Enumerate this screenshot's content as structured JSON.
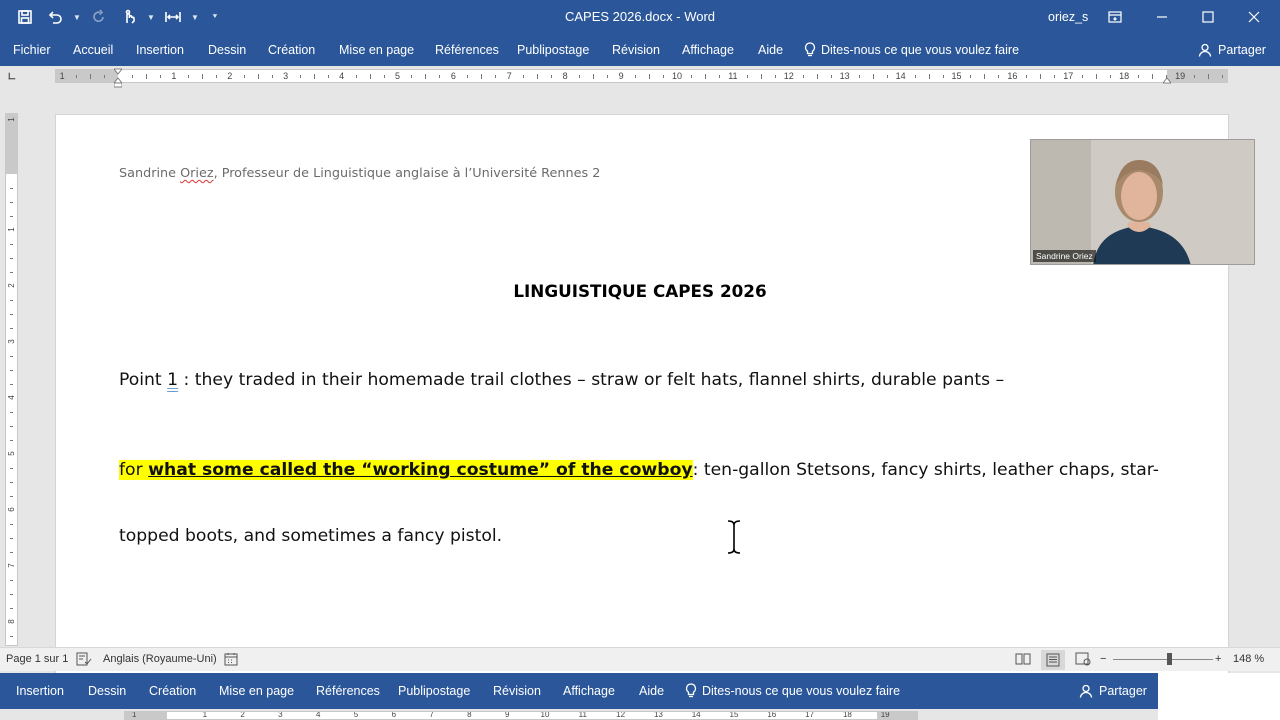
{
  "window": {
    "title": "CAPES 2026.docx - Word",
    "user": "oriez_s"
  },
  "ribbon": {
    "tabs": [
      "Fichier",
      "Accueil",
      "Insertion",
      "Dessin",
      "Création",
      "Mise en page",
      "Références",
      "Publipostage",
      "Révision",
      "Affichage",
      "Aide"
    ],
    "tell_me": "Dites-nous ce que vous voulez faire",
    "share": "Partager"
  },
  "ruler": {
    "labels": [
      "1",
      "1",
      "2",
      "3",
      "4",
      "5",
      "6",
      "7",
      "8",
      "9",
      "10",
      "11",
      "12",
      "13",
      "14",
      "15",
      "16",
      "17",
      "18",
      "19"
    ],
    "vertical_labels": [
      "1",
      "1",
      "2",
      "3",
      "4",
      "5",
      "6",
      "7",
      "8"
    ]
  },
  "document": {
    "header_name": "Oriez",
    "header_prefix": "Sandrine ",
    "header_suffix": ", Professeur de Linguistique anglaise à l’Université Rennes 2",
    "title": "LINGUISTIQUE CAPES 2026",
    "p1_prefix": "Point ",
    "p1_num": "1",
    "p1_rest": " : they traded in their homemade trail clothes – straw or felt hats, flannel shirts, durable pants –",
    "p2_for": "for ",
    "p2_highlight": "what some called the “working costume” of the cowboy",
    "p2_rest": ": ten-gallon Stetsons, fancy shirts, leather chaps, star-",
    "p3": "topped boots, and sometimes a fancy pistol."
  },
  "webcam": {
    "name": "Sandrine Oriez"
  },
  "status": {
    "page": "Page 1 sur 1",
    "language": "Anglais (Royaume-Uni)",
    "zoom": "148 %",
    "zoom_value": 148
  },
  "ribbon_bottom": {
    "tabs": [
      "Insertion",
      "Dessin",
      "Création",
      "Mise en page",
      "Références",
      "Publipostage",
      "Révision",
      "Affichage",
      "Aide"
    ],
    "tell_me": "Dites-nous ce que vous voulez faire",
    "share": "Partager"
  },
  "ruler_bottom": {
    "labels": [
      "1",
      "1",
      "2",
      "3",
      "4",
      "5",
      "6",
      "7",
      "8",
      "9",
      "10",
      "11",
      "12",
      "13",
      "14",
      "15",
      "16",
      "17",
      "18",
      "19"
    ]
  },
  "colors": {
    "ribbon": "#2b579a",
    "highlight": "#ffff00"
  }
}
